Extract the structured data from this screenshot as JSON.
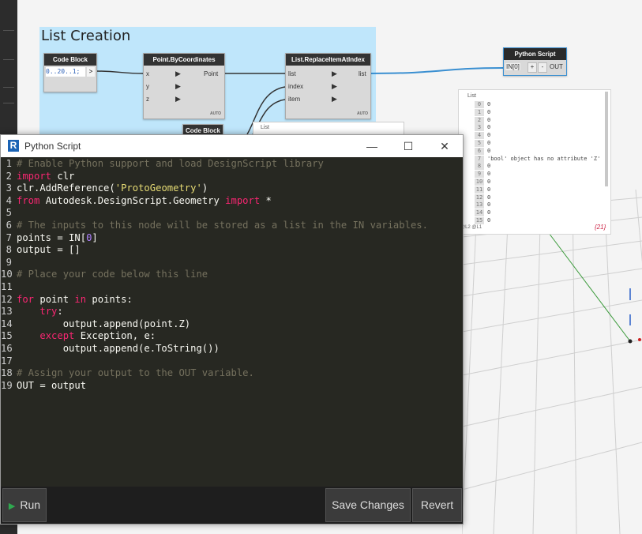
{
  "canvas": {
    "group_title": "List Creation",
    "nodes": {
      "code_block": {
        "title": "Code Block",
        "code": "0..20..1;",
        "out": ">"
      },
      "point_by_coords": {
        "title": "Point.ByCoordinates",
        "inputs": [
          "x",
          "y",
          "z"
        ],
        "output": "Point",
        "lacing": "AUTO"
      },
      "replace_item": {
        "title": "List.ReplaceItemAtIndex",
        "inputs": [
          "list",
          "index",
          "item"
        ],
        "output": "list",
        "lacing": "AUTO"
      },
      "code_block_2": {
        "title": "Code Block"
      },
      "python_script": {
        "title": "Python Script",
        "input": "IN[0]",
        "add": "+",
        "remove": "-",
        "output": "OUT"
      }
    },
    "back_watch_label": "List",
    "watch": {
      "header": "List",
      "rows": [
        {
          "i": "0",
          "v": "0"
        },
        {
          "i": "1",
          "v": "0"
        },
        {
          "i": "2",
          "v": "0"
        },
        {
          "i": "3",
          "v": "0"
        },
        {
          "i": "4",
          "v": "0"
        },
        {
          "i": "5",
          "v": "0"
        },
        {
          "i": "6",
          "v": "0"
        },
        {
          "i": "7",
          "v": "'bool' object has no attribute 'Z'"
        },
        {
          "i": "8",
          "v": "0"
        },
        {
          "i": "9",
          "v": "0"
        },
        {
          "i": "10",
          "v": "0"
        },
        {
          "i": "11",
          "v": "0"
        },
        {
          "i": "12",
          "v": "0"
        },
        {
          "i": "13",
          "v": "0"
        },
        {
          "i": "14",
          "v": "0"
        },
        {
          "i": "15",
          "v": "0"
        }
      ],
      "levels": "@L2 @L1",
      "count": "{21}"
    }
  },
  "python_window": {
    "title": "Python Script",
    "controls": {
      "minimize": "—",
      "maximize": "☐",
      "close": "✕"
    },
    "code_lines": [
      "# Enable Python support and load DesignScript library",
      "import clr",
      "clr.AddReference('ProtoGeometry')",
      "from Autodesk.DesignScript.Geometry import *",
      "",
      "# The inputs to this node will be stored as a list in the IN variables.",
      "points = IN[0]",
      "output = []",
      "",
      "# Place your code below this line",
      "",
      "for point in points:",
      "    try:",
      "        output.append(point.Z)",
      "    except Exception, e:",
      "        output.append(e.ToString())",
      "",
      "# Assign your output to the OUT variable.",
      "OUT = output"
    ],
    "buttons": {
      "run": "Run",
      "save": "Save Changes",
      "revert": "Revert"
    }
  },
  "colors": {
    "editor_bg": "#272822",
    "group_bg": "#bfe6fb",
    "wire_blue": "#3a8fd1",
    "keyword": "#f92672",
    "comment": "#75715e",
    "string": "#e6db74"
  }
}
